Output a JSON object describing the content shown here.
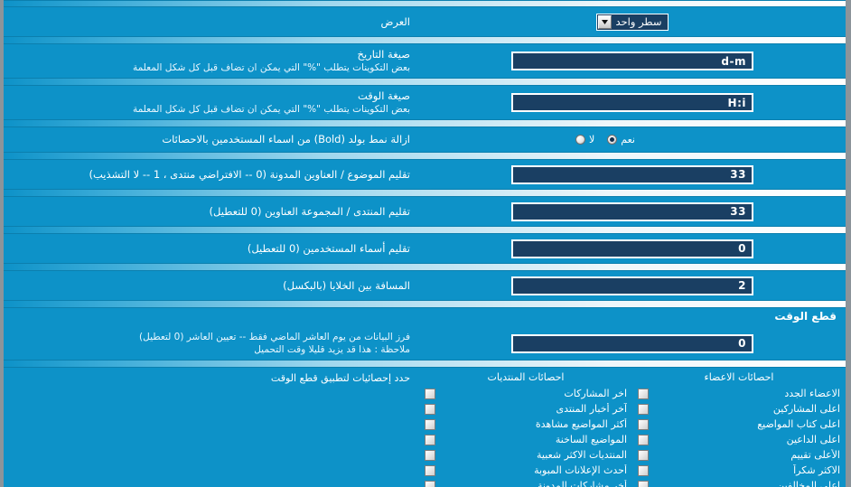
{
  "display_row": {
    "label": "العرض",
    "select_value": "سطر واحد",
    "arrow_icon": "chevron-down-icon"
  },
  "rows": [
    {
      "title": "صيغة التاريخ",
      "desc": "بعض التكوينات يتطلب \"%\" التي يمكن ان تضاف قبل كل شكل المعلمة",
      "value": "d-m"
    },
    {
      "title": "صيغة الوقت",
      "desc": "بعض التكوينات يتطلب \"%\" التي يمكن ان تضاف قبل كل شكل المعلمة",
      "value": "H:i"
    }
  ],
  "bold_row": {
    "label": "ازالة نمط بولد (Bold) من اسماء المستخدمين بالاحصائات",
    "options": [
      {
        "label": "نعم",
        "selected": true
      },
      {
        "label": "لا",
        "selected": false
      }
    ]
  },
  "numeric_rows": [
    {
      "label": "تقليم الموضوع / العناوين المدونة (0 -- الافتراضي منتدى ، 1 -- لا التشذيب)",
      "value": "33"
    },
    {
      "label": "تقليم المنتدى / المجموعة العناوين (0 للتعطيل)",
      "value": "33"
    },
    {
      "label": "تقليم أسماء المستخدمين (0 للتعطيل)",
      "value": "0"
    },
    {
      "label": "المسافة بين الخلايا (بالبكسل)",
      "value": "2"
    }
  ],
  "section_header": "قطع الوقت",
  "cutoff_row": {
    "desc_line1": "فرز البيانات من يوم العاشر الماضي فقط -- تعيين العاشر (0 لتعطيل)",
    "desc_line2": "ملاحظة : هذا قد يزيد قليلا وقت التحميل",
    "value": "0"
  },
  "stats": {
    "label": "حدد إحصائيات لتطبيق قطع الوقت",
    "columns": [
      {
        "head": "احصائات المنتديات",
        "items": [
          {
            "label": "اخر المشاركات",
            "checked": false
          },
          {
            "label": "آخر أخبار المنتدى",
            "checked": false
          },
          {
            "label": "أكثر المواضيع مشاهدة",
            "checked": false
          },
          {
            "label": "المواضيع الساخنة",
            "checked": false
          },
          {
            "label": "المنتديات الاكثر شعبية",
            "checked": false
          },
          {
            "label": "أحدث الإعلانات المبوبة",
            "checked": false
          },
          {
            "label": "أخر مشاركات المدونة",
            "checked": false
          }
        ]
      },
      {
        "head": "احصائات الاعضاء",
        "items": [
          {
            "label": "الاعضاء الجدد",
            "checked": false
          },
          {
            "label": "اعلى المشاركين",
            "checked": false
          },
          {
            "label": "اعلى كتاب المواضيع",
            "checked": false
          },
          {
            "label": "اعلى الداعين",
            "checked": false
          },
          {
            "label": "الأعلى تقييم",
            "checked": false
          },
          {
            "label": "الاكثر شكراً",
            "checked": false
          },
          {
            "label": "اعلى المخالفين",
            "checked": false
          }
        ]
      }
    ]
  },
  "colors": {
    "page_bg": "#0d92c8",
    "field_bg": "#1a3f63",
    "text": "#ffffff",
    "frame": "#8c949a"
  }
}
